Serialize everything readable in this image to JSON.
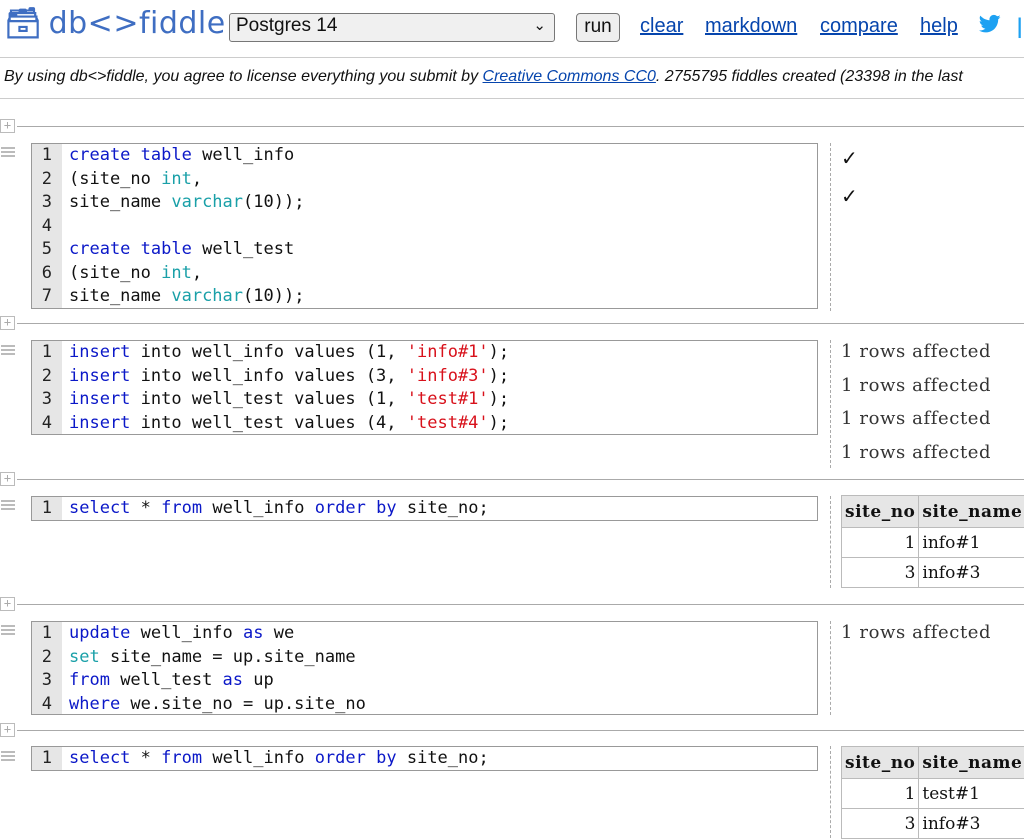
{
  "header": {
    "logo_text": "db<>fiddle",
    "logo_icon": "db-logo-icon",
    "db_select_value": "Postgres 14",
    "run_label": "run",
    "nav": [
      "clear",
      "markdown",
      "compare",
      "help"
    ],
    "twitter_icon": "twitter-icon"
  },
  "license": {
    "prefix": "By using db<>fiddle, you agree to license everything you submit by ",
    "link": "Creative Commons CC0",
    "suffix": ". 2755795 fiddles created (23398 in the last"
  },
  "fiddles": [
    {
      "lines": [
        "create table well_info",
        "(site_no int,",
        "site_name varchar(10));",
        "",
        "create table well_test",
        "(site_no int,",
        "site_name varchar(10));"
      ],
      "output": {
        "type": "checks",
        "items": [
          "✓",
          "✓"
        ]
      }
    },
    {
      "lines": [
        "insert into well_info values (1, 'info#1');",
        "insert into well_info values (3, 'info#3');",
        "insert into well_test values (1, 'test#1');",
        "insert into well_test values (4, 'test#4');"
      ],
      "output": {
        "type": "affected",
        "items": [
          "1 rows affected",
          "1 rows affected",
          "1 rows affected",
          "1 rows affected"
        ]
      }
    },
    {
      "lines": [
        "select * from well_info order by site_no;"
      ],
      "output": {
        "type": "table",
        "columns": [
          "site_no",
          "site_name"
        ],
        "rows": [
          [
            "1",
            "info#1"
          ],
          [
            "3",
            "info#3"
          ]
        ]
      }
    },
    {
      "lines": [
        "update well_info as we",
        "set site_name = up.site_name",
        "from well_test as up",
        "where we.site_no = up.site_no"
      ],
      "output": {
        "type": "affected",
        "items": [
          "1 rows affected"
        ]
      }
    },
    {
      "lines": [
        "select * from well_info order by site_no;"
      ],
      "output": {
        "type": "table",
        "columns": [
          "site_no",
          "site_name"
        ],
        "rows": [
          [
            "1",
            "test#1"
          ],
          [
            "3",
            "info#3"
          ]
        ]
      }
    }
  ]
}
